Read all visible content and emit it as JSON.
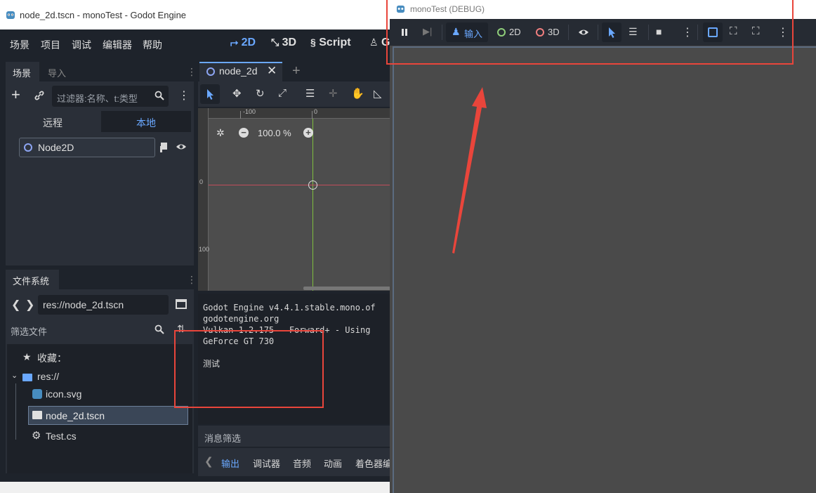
{
  "editor": {
    "window_title": "node_2d.tscn - monoTest - Godot Engine",
    "menu": [
      "场景",
      "项目",
      "调试",
      "编辑器",
      "帮助"
    ],
    "modes": [
      {
        "label": "2D",
        "active": true
      },
      {
        "label": "3D",
        "active": false
      },
      {
        "label": "Script",
        "active": false
      },
      {
        "label": "G",
        "active": false
      }
    ],
    "scene_dock": {
      "tabs": [
        "场景",
        "导入"
      ],
      "filter_placeholder": "过滤器:名称、t:类型",
      "remote_label": "远程",
      "local_label": "本地",
      "root_node": "Node2D"
    },
    "filesystem_dock": {
      "tab": "文件系统",
      "path": "res://node_2d.tscn",
      "filter_placeholder": "筛选文件",
      "favorites": "收藏：",
      "root": "res://",
      "files": [
        {
          "name": "icon.svg",
          "selected": false
        },
        {
          "name": "node_2d.tscn",
          "selected": true
        },
        {
          "name": "Test.cs",
          "selected": false
        }
      ]
    },
    "scene_tab": "node_2d",
    "zoom": "100.0 %",
    "ruler": {
      "minus100": "-100",
      "zero": "0",
      "vzero": "0",
      "v100": "100"
    },
    "output_lines": [
      "Godot Engine v4.4.1.stable.mono.of",
      "godotengine.org",
      "Vulkan 1.2.175 - Forward+ - Using",
      "GeForce GT 730",
      "",
      "测试"
    ],
    "message_filter": "消息筛选",
    "bottom_tabs": [
      "输出",
      "调试器",
      "音频",
      "动画",
      "着色器编"
    ]
  },
  "debug": {
    "window_title": "monoTest (DEBUG)",
    "input_label": "输入",
    "label_2d": "2D",
    "label_3d": "3D"
  },
  "colors": {
    "accent": "#6aa8ff",
    "annotation_red": "#e9453b",
    "editor_bg": "#1e232b",
    "panel_bg": "#2a2f38",
    "game_bg": "#484848"
  }
}
